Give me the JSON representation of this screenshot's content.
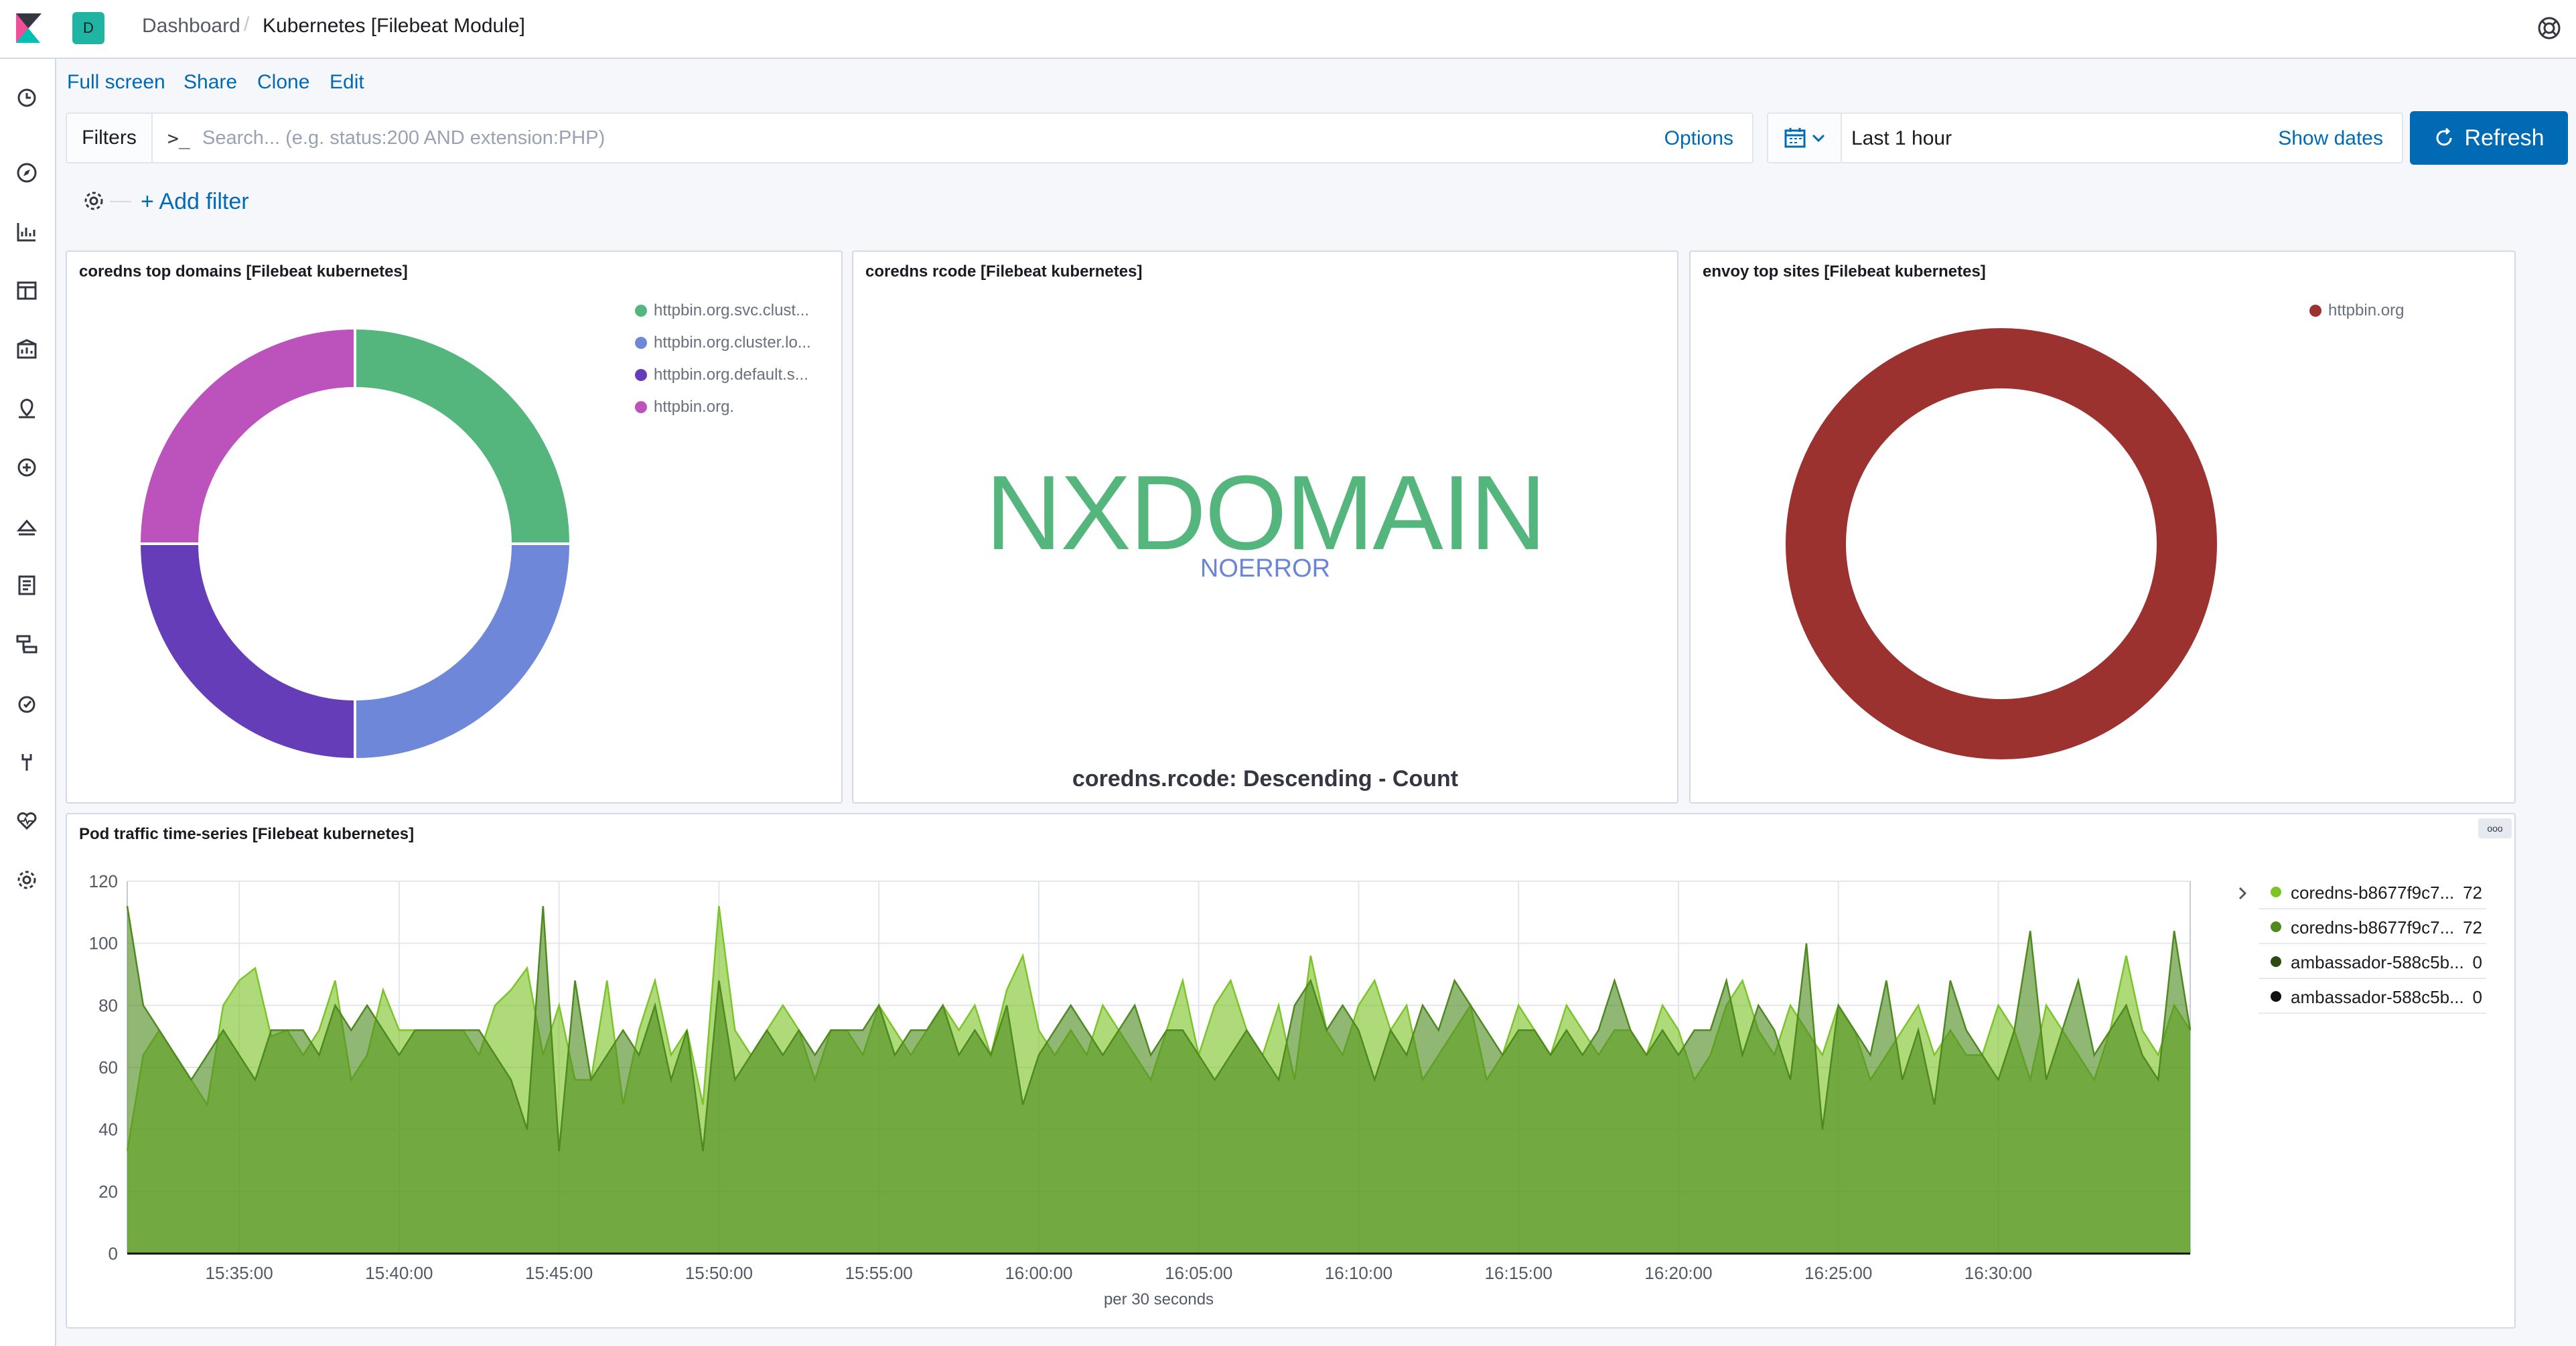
{
  "header": {
    "space_initial": "D",
    "breadcrumb_root": "Dashboard",
    "breadcrumb_separator": "/",
    "breadcrumb_current": "Kubernetes [Filebeat Module]"
  },
  "top_menu": {
    "full_screen": "Full screen",
    "share": "Share",
    "clone": "Clone",
    "edit": "Edit"
  },
  "filter_bar": {
    "filters_label": "Filters",
    "query_icon_text": ">_",
    "search_placeholder": "Search... (e.g. status:200 AND extension:PHP)",
    "options": "Options",
    "date_range": "Last 1 hour",
    "show_dates": "Show dates",
    "refresh": "Refresh",
    "add_filter": "+ Add filter"
  },
  "panels": {
    "top_domains": {
      "title": "coredns top domains [Filebeat kubernetes]",
      "legend": [
        {
          "label": "httpbin.org.svc.clust...",
          "color": "#54b67c"
        },
        {
          "label": "httpbin.org.cluster.lo...",
          "color": "#6f87d8"
        },
        {
          "label": "httpbin.org.default.s...",
          "color": "#663db8"
        },
        {
          "label": "httpbin.org.",
          "color": "#bc52bc"
        }
      ]
    },
    "rcode": {
      "title": "coredns rcode [Filebeat kubernetes]",
      "main_value": "NXDOMAIN",
      "secondary_value": "NOERROR",
      "caption": "coredns.rcode: Descending - Count"
    },
    "envoy": {
      "title": "envoy top sites [Filebeat kubernetes]",
      "legend": [
        {
          "label": "httpbin.org",
          "color": "#9c3230"
        }
      ]
    },
    "timeseries": {
      "title": "Pod traffic time-series [Filebeat kubernetes]",
      "menu_text": "ooo",
      "legend": [
        {
          "label": "coredns-b8677f9c7...",
          "value": "72",
          "color": "#7cc428"
        },
        {
          "label": "coredns-b8677f9c7...",
          "value": "72",
          "color": "#4e8a1e"
        },
        {
          "label": "ambassador-588c5b...",
          "value": "0",
          "color": "#2d4a12"
        },
        {
          "label": "ambassador-588c5b...",
          "value": "0",
          "color": "#111111"
        }
      ]
    }
  },
  "chart_data": [
    {
      "type": "pie",
      "variant": "donut",
      "title": "coredns top domains [Filebeat kubernetes]",
      "categories": [
        "httpbin.org.svc.clust...",
        "httpbin.org.cluster.lo...",
        "httpbin.org.default.s...",
        "httpbin.org."
      ],
      "values": [
        25,
        25,
        25,
        25
      ],
      "colors": [
        "#54b67c",
        "#6f87d8",
        "#663db8",
        "#bc52bc"
      ],
      "legend": "top-right"
    },
    {
      "type": "pie",
      "variant": "donut",
      "title": "envoy top sites [Filebeat kubernetes]",
      "categories": [
        "httpbin.org"
      ],
      "values": [
        100
      ],
      "colors": [
        "#9c3230"
      ],
      "legend": "top-right"
    },
    {
      "type": "area",
      "title": "Pod traffic time-series [Filebeat kubernetes]",
      "xlabel": "per 30 seconds",
      "ylabel": "",
      "ylim": [
        0,
        120
      ],
      "yticks": [
        0,
        20,
        40,
        60,
        80,
        100,
        120
      ],
      "xticks": [
        "15:35:00",
        "15:40:00",
        "15:45:00",
        "15:50:00",
        "15:55:00",
        "16:00:00",
        "16:05:00",
        "16:10:00",
        "16:15:00",
        "16:20:00",
        "16:25:00",
        "16:30:00"
      ],
      "x_start": "15:31:30",
      "x_interval_seconds": 30,
      "grid": true,
      "legend": "right",
      "series": [
        {
          "name": "coredns-b8677f9c7...",
          "color": "#7cc428",
          "values": [
            33,
            64,
            72,
            64,
            56,
            48,
            80,
            88,
            92,
            70,
            72,
            64,
            72,
            88,
            56,
            64,
            85,
            72,
            72,
            72,
            72,
            72,
            64,
            80,
            85,
            92,
            64,
            80,
            56,
            56,
            88,
            48,
            72,
            88,
            64,
            72,
            48,
            112,
            72,
            64,
            72,
            80,
            72,
            56,
            72,
            72,
            64,
            80,
            72,
            64,
            72,
            80,
            72,
            80,
            64,
            85,
            96,
            72,
            64,
            72,
            64,
            80,
            72,
            64,
            56,
            72,
            88,
            64,
            80,
            88,
            72,
            64,
            80,
            56,
            96,
            72,
            64,
            80,
            88,
            72,
            80,
            56,
            64,
            72,
            80,
            56,
            64,
            80,
            72,
            64,
            80,
            72,
            64,
            72,
            72,
            64,
            80,
            72,
            56,
            64,
            80,
            88,
            72,
            64,
            80,
            72,
            64,
            80,
            72,
            56,
            64,
            72,
            80,
            64,
            72,
            64,
            64,
            80,
            72,
            56,
            80,
            72,
            64,
            56,
            72,
            96,
            72,
            64,
            80,
            72
          ]
        },
        {
          "name": "coredns-b8677f9c7...",
          "color": "#4e8a1e",
          "values": [
            112,
            80,
            72,
            64,
            56,
            64,
            72,
            64,
            56,
            72,
            72,
            72,
            64,
            80,
            72,
            80,
            72,
            64,
            72,
            72,
            72,
            72,
            72,
            64,
            56,
            40,
            112,
            33,
            88,
            56,
            64,
            72,
            64,
            80,
            56,
            72,
            33,
            88,
            56,
            64,
            72,
            64,
            72,
            64,
            72,
            72,
            72,
            80,
            64,
            72,
            72,
            80,
            64,
            72,
            64,
            80,
            48,
            64,
            72,
            80,
            72,
            64,
            72,
            80,
            64,
            72,
            72,
            64,
            56,
            64,
            72,
            64,
            56,
            80,
            88,
            72,
            80,
            72,
            56,
            72,
            64,
            80,
            72,
            88,
            80,
            72,
            64,
            72,
            72,
            64,
            72,
            64,
            72,
            88,
            72,
            64,
            72,
            64,
            72,
            72,
            88,
            64,
            80,
            72,
            56,
            100,
            40,
            80,
            72,
            64,
            88,
            56,
            72,
            48,
            88,
            72,
            64,
            56,
            72,
            104,
            56,
            72,
            88,
            64,
            72,
            80,
            64,
            56,
            104,
            72
          ]
        },
        {
          "name": "ambassador-588c5b...",
          "color": "#2d4a12",
          "values": [
            0
          ]
        },
        {
          "name": "ambassador-588c5b...",
          "color": "#111111",
          "values": [
            0
          ]
        }
      ]
    }
  ]
}
